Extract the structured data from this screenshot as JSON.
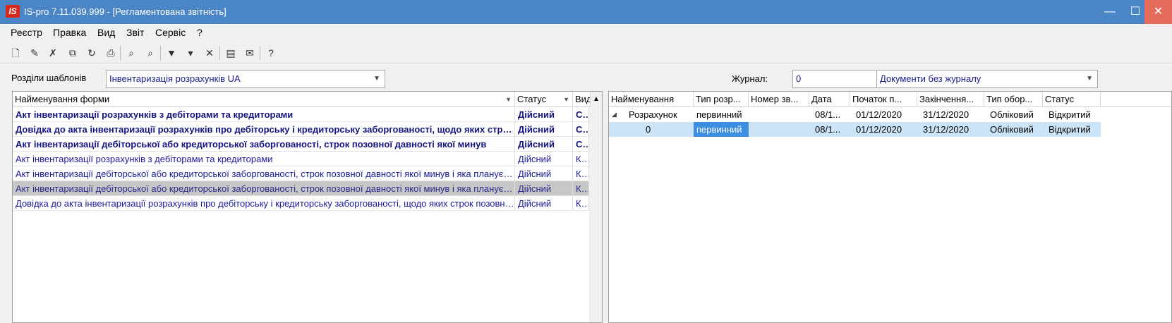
{
  "window": {
    "title": "IS-pro 7.11.039.999 - [Регламентована звітність]",
    "logo": "IS",
    "min": "—",
    "max": "☐",
    "close": "✕"
  },
  "menu": [
    "Реєстр",
    "Правка",
    "Вид",
    "Звіт",
    "Сервіс",
    "?"
  ],
  "toolbar": {
    "icons": [
      "new-doc-icon",
      "edit-doc-icon",
      "delete-doc-icon",
      "copy-doc-icon",
      "refresh-icon",
      "print-icon",
      "find-icon",
      "find-next-icon",
      "filter-icon",
      "filter-add-icon",
      "filter-clear-icon",
      "document-icon",
      "mail-icon",
      "help-icon"
    ]
  },
  "templates": {
    "label": "Розділи шаблонів",
    "value": "Інвентаризація розрахунків UA"
  },
  "journal": {
    "label": "Журнал:",
    "code": "0",
    "value": "Документи без журналу"
  },
  "left_grid": {
    "columns": [
      "Найменування форми",
      "Статус",
      "Вид"
    ],
    "rows": [
      {
        "name": "Акт інвентаризації розрахунків з дебіторами та кредиторами",
        "status": "Дійсний",
        "kind": "Сис",
        "bold": true
      },
      {
        "name": "Довідка до акта інвентаризації розрахунків про дебіторську і кредиторську заборгованості, щодо яких строк позовної давності минув",
        "status": "Дійсний",
        "kind": "Сис",
        "bold": true
      },
      {
        "name": "Акт інвентаризації дебіторської або кредиторської заборгованості, строк позовної давності якої минув",
        "status": "Дійсний",
        "kind": "Сис",
        "bold": true
      },
      {
        "name": "Акт інвентаризації розрахунків з дебіторами та кредиторами",
        "status": "Дійсний",
        "kind": "Кор",
        "bold": false
      },
      {
        "name": "Акт інвентаризації дебіторської або кредиторської заборгованості, строк позовної давності якої минув і яка планується",
        "status": "Дійсний",
        "kind": "Кор",
        "bold": false
      },
      {
        "name": "Акт інвентаризації дебіторської або кредиторської заборгованості, строк позовної давності якої минув і яка планується",
        "status": "Дійсний",
        "kind": "Кор",
        "bold": false,
        "selected": true
      },
      {
        "name": "Довідка до акта інвентаризації розрахунків про дебіторську і кредиторську заборгованості, щодо яких строк позовної давності",
        "status": "Дійсний",
        "kind": "Кор",
        "bold": false
      }
    ]
  },
  "right_grid": {
    "columns": [
      "Найменування",
      "Тип розр...",
      "Номер зв...",
      "Дата",
      "Початок п...",
      "Закінчення...",
      "Тип обор...",
      "Статус"
    ],
    "rows": [
      {
        "name": "Розрахунок",
        "type": "первинний",
        "num": "",
        "date": "08/1...",
        "start": "01/12/2020",
        "end": "31/12/2020",
        "turnover": "Обліковий",
        "status": "Відкритий",
        "expand": "◢"
      },
      {
        "name": "0",
        "type": "первинний",
        "num": "",
        "date": "08/1...",
        "start": "01/12/2020",
        "end": "31/12/2020",
        "turnover": "Обліковий",
        "status": "Відкритий",
        "selected": true
      }
    ]
  }
}
